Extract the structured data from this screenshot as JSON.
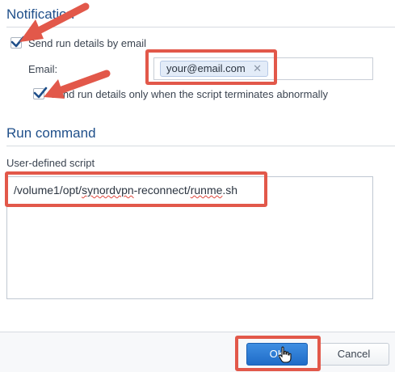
{
  "notification": {
    "title": "Notification",
    "send_email_label": "Send run details by email",
    "send_email_checked": true,
    "email_label": "Email:",
    "email_tag": "your@email.com",
    "abnormal_only_label": "Send run details only when the script terminates abnormally",
    "abnormal_only_checked": true
  },
  "run_command": {
    "title": "Run command",
    "script_label": "User-defined script",
    "script_prefix": "/volume1/opt/",
    "script_misspelled": "synordvpn",
    "script_suffix": "-reconnect/",
    "script_misspelled2": "runme",
    "script_ext": ".sh"
  },
  "footer": {
    "ok_label": "OK",
    "cancel_label": "Cancel"
  },
  "annotations": {
    "highlight_color": "#e2584a"
  }
}
